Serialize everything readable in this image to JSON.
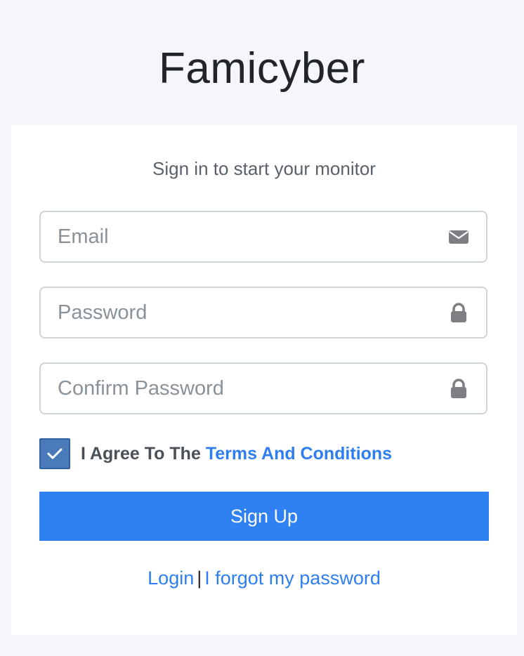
{
  "brand": {
    "title": "Famicyber"
  },
  "form": {
    "message": "Sign in to start your monitor",
    "email_placeholder": "Email",
    "password_placeholder": "Password",
    "confirm_placeholder": "Confirm Password",
    "agree_checked": true,
    "agree_prefix": "I Agree To The",
    "terms_link": "Terms And Conditions",
    "submit_label": "Sign Up",
    "separator": "|",
    "login_link": "Login",
    "forgot_link": "I forgot my password"
  },
  "icons": {
    "email": "envelope-icon",
    "password": "lock-icon",
    "confirm": "lock-icon",
    "checkbox": "check-icon"
  },
  "colors": {
    "background": "#f4f6f9",
    "accent": "#2f80f0",
    "checkbox": "#4a7ab8"
  }
}
